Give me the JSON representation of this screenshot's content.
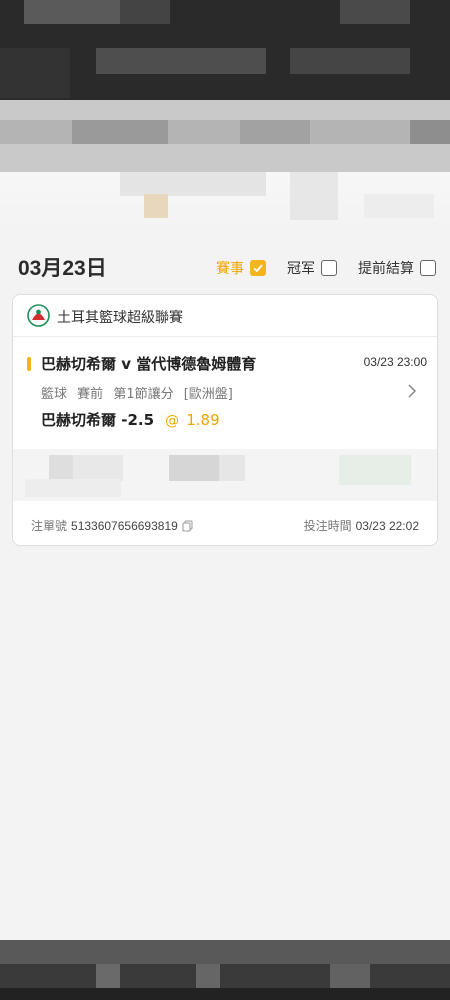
{
  "filter_bar": {
    "date": "03月23日",
    "options": [
      {
        "label": "賽事",
        "checked": true
      },
      {
        "label": "冠军",
        "checked": false
      },
      {
        "label": "提前結算",
        "checked": false
      }
    ]
  },
  "card": {
    "league": "土耳其籃球超級聯賽",
    "match": "巴赫切希爾 v 當代博德魯姆體育",
    "match_time": "03/23 23:00",
    "meta": [
      "籃球",
      "賽前",
      "第1節讓分",
      "[歐洲盤]"
    ],
    "selection": "巴赫切希爾 -2.5",
    "at_symbol": "@",
    "odds": "1.89",
    "order_label": "注單號",
    "order_number": "5133607656693819",
    "bet_time_label": "投注時間",
    "bet_time": "03/23 22:02"
  },
  "colors": {
    "accent": "#f5b51c",
    "odds": "#f0a500",
    "background": "#f3f3f3"
  },
  "icons": [
    "checkbox-checked-icon",
    "checkbox-icon",
    "league-logo-icon",
    "chevron-right-icon",
    "copy-icon"
  ]
}
